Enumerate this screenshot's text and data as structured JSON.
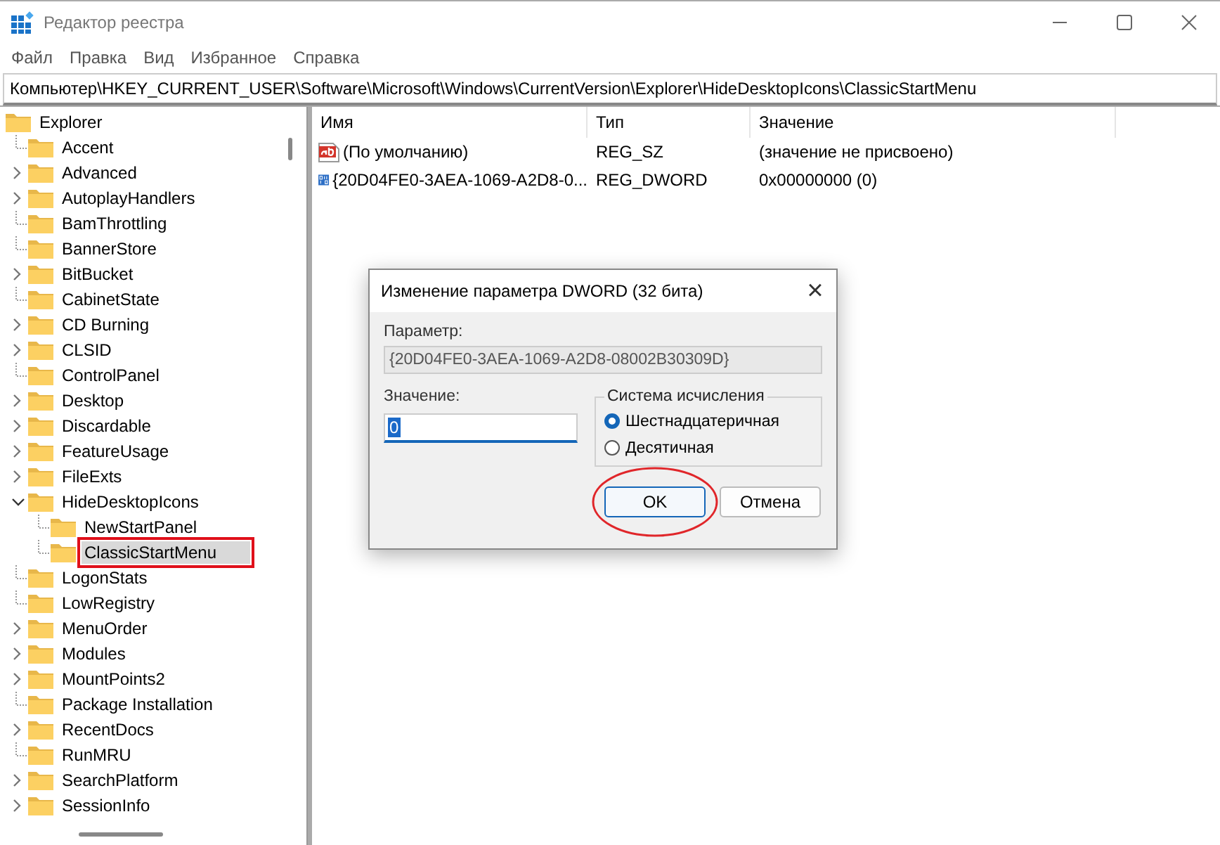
{
  "window": {
    "title": "Редактор реестра"
  },
  "menu": [
    "Файл",
    "Правка",
    "Вид",
    "Избранное",
    "Справка"
  ],
  "address": "Компьютер\\HKEY_CURRENT_USER\\Software\\Microsoft\\Windows\\CurrentVersion\\Explorer\\HideDesktopIcons\\ClassicStartMenu",
  "tree": {
    "label": "Explorer",
    "selected": false,
    "highlighted": false,
    "children": [
      {
        "label": "Accent",
        "expandable": false,
        "expanded": false,
        "selected": false,
        "highlighted": false
      },
      {
        "label": "Advanced",
        "expandable": true,
        "expanded": false,
        "selected": false,
        "highlighted": false
      },
      {
        "label": "AutoplayHandlers",
        "expandable": true,
        "expanded": false,
        "selected": false,
        "highlighted": false
      },
      {
        "label": "BamThrottling",
        "expandable": false,
        "expanded": false,
        "selected": false,
        "highlighted": false
      },
      {
        "label": "BannerStore",
        "expandable": false,
        "expanded": false,
        "selected": false,
        "highlighted": false
      },
      {
        "label": "BitBucket",
        "expandable": true,
        "expanded": false,
        "selected": false,
        "highlighted": false
      },
      {
        "label": "CabinetState",
        "expandable": false,
        "expanded": false,
        "selected": false,
        "highlighted": false
      },
      {
        "label": "CD Burning",
        "expandable": true,
        "expanded": false,
        "selected": false,
        "highlighted": false
      },
      {
        "label": "CLSID",
        "expandable": true,
        "expanded": false,
        "selected": false,
        "highlighted": false
      },
      {
        "label": "ControlPanel",
        "expandable": false,
        "expanded": false,
        "selected": false,
        "highlighted": false
      },
      {
        "label": "Desktop",
        "expandable": true,
        "expanded": false,
        "selected": false,
        "highlighted": false
      },
      {
        "label": "Discardable",
        "expandable": true,
        "expanded": false,
        "selected": false,
        "highlighted": false
      },
      {
        "label": "FeatureUsage",
        "expandable": true,
        "expanded": false,
        "selected": false,
        "highlighted": false
      },
      {
        "label": "FileExts",
        "expandable": true,
        "expanded": false,
        "selected": false,
        "highlighted": false
      },
      {
        "label": "HideDesktopIcons",
        "expandable": true,
        "expanded": true,
        "selected": false,
        "highlighted": false,
        "children": [
          {
            "label": "NewStartPanel",
            "expandable": false,
            "expanded": false,
            "selected": false,
            "highlighted": false
          },
          {
            "label": "ClassicStartMenu",
            "expandable": false,
            "expanded": false,
            "selected": true,
            "highlighted": true
          }
        ]
      },
      {
        "label": "LogonStats",
        "expandable": false,
        "expanded": false,
        "selected": false,
        "highlighted": false
      },
      {
        "label": "LowRegistry",
        "expandable": false,
        "expanded": false,
        "selected": false,
        "highlighted": false
      },
      {
        "label": "MenuOrder",
        "expandable": true,
        "expanded": false,
        "selected": false,
        "highlighted": false
      },
      {
        "label": "Modules",
        "expandable": true,
        "expanded": false,
        "selected": false,
        "highlighted": false
      },
      {
        "label": "MountPoints2",
        "expandable": true,
        "expanded": false,
        "selected": false,
        "highlighted": false
      },
      {
        "label": "Package Installation",
        "expandable": false,
        "expanded": false,
        "selected": false,
        "highlighted": false
      },
      {
        "label": "RecentDocs",
        "expandable": true,
        "expanded": false,
        "selected": false,
        "highlighted": false
      },
      {
        "label": "RunMRU",
        "expandable": false,
        "expanded": false,
        "selected": false,
        "highlighted": false
      },
      {
        "label": "SearchPlatform",
        "expandable": true,
        "expanded": false,
        "selected": false,
        "highlighted": false
      },
      {
        "label": "SessionInfo",
        "expandable": true,
        "expanded": false,
        "selected": false,
        "highlighted": false
      }
    ]
  },
  "table": {
    "columns": [
      "Имя",
      "Тип",
      "Значение"
    ],
    "rows": [
      {
        "kind": "string",
        "name": "(По умолчанию)",
        "type": "REG_SZ",
        "value": "(значение не присвоено)"
      },
      {
        "kind": "binary",
        "name": "{20D04FE0-3AEA-1069-A2D8-0...",
        "type": "REG_DWORD",
        "value": "0x00000000 (0)"
      }
    ]
  },
  "dialog": {
    "title": "Изменение параметра DWORD (32 бита)",
    "close": "×",
    "param_label": "Параметр:",
    "param_value": "{20D04FE0-3AEA-1069-A2D8-08002B30309D}",
    "value_label": "Значение:",
    "value": "0",
    "base_group": "Система исчисления",
    "bases": [
      {
        "label": "Шестнадцатеричная",
        "selected": true
      },
      {
        "label": "Десятичная",
        "selected": false
      }
    ],
    "buttons": [
      {
        "label": "OK",
        "default": true,
        "circled": true
      },
      {
        "label": "Отмена",
        "default": false,
        "circled": false
      }
    ]
  }
}
